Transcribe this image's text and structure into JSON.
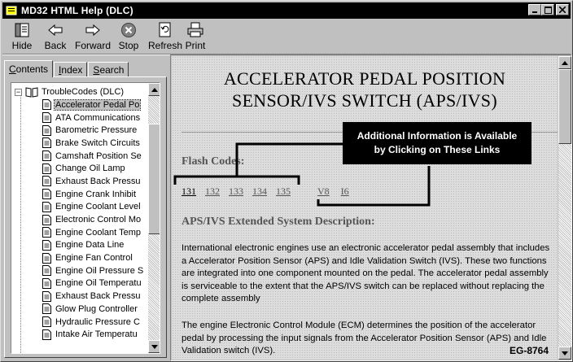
{
  "window": {
    "title": "MD32 HTML Help (DLC)"
  },
  "toolbar": {
    "buttons": [
      {
        "label": "Hide",
        "icon": "hide-icon"
      },
      {
        "label": "Back",
        "icon": "back-arrow-icon"
      },
      {
        "label": "Forward",
        "icon": "forward-arrow-icon"
      },
      {
        "label": "Stop",
        "icon": "stop-icon"
      },
      {
        "label": "Refresh",
        "icon": "refresh-icon"
      },
      {
        "label": "Print",
        "icon": "print-icon"
      }
    ]
  },
  "tabs": [
    {
      "label": "Contents",
      "underline": "C",
      "rest": "ontents",
      "active": true
    },
    {
      "label": "Index",
      "underline": "I",
      "rest": "ndex",
      "active": false
    },
    {
      "label": "Search",
      "underline": "S",
      "rest": "earch",
      "active": false
    }
  ],
  "tree": {
    "root": {
      "label": "TroubleCodes (DLC)",
      "expanded": true
    },
    "items": [
      "Accelerator Pedal Po",
      "ATA Communications",
      "Barometric Pressure",
      "Brake Switch Circuits",
      "Camshaft Position Se",
      "Change Oil Lamp",
      "Exhaust Back Pressu",
      "Engine Crank Inhibit",
      "Engine Coolant Level",
      "Electronic Control Mo",
      "Engine Coolant Temp",
      "Engine Data Line",
      "Engine Fan Control",
      "Engine Oil Pressure S",
      "Engine Oil Temperatu",
      "Exhaust Back Pressu",
      "Glow Plug Controller",
      "Hydraulic Pressure C",
      "Intake Air Temperatu"
    ],
    "selected_index": 0
  },
  "content": {
    "title_line1": "ACCELERATOR PEDAL POSITION",
    "title_line2": "SENSOR/IVS SWITCH (APS/IVS)",
    "callout_line1": "Additional Information is  Available",
    "callout_line2": "by Clicking on These Links",
    "flash_label": "Flash Codes:",
    "flash_codes": [
      "131",
      "132",
      "133",
      "134",
      "135"
    ],
    "extra_links": [
      "V8",
      "I6"
    ],
    "section_title": "APS/IVS Extended System Description:",
    "paragraph1": "International electronic engines use an electronic accelerator pedal assembly that includes a Accelerator Position Sensor (APS) and Idle Validation Switch (IVS).  These two functions are integrated into one component mounted on the pedal.  The accelerator pedal assembly is serviceable to the extent that the APS/IVS switch can be replaced without replacing the complete assembly",
    "paragraph2": "The engine Electronic Control Module (ECM) determines the position of the accelerator pedal by processing the input signals from the Accelerator Position Sensor (APS) and Idle Validation switch (IVS).",
    "figure_id": "EG-8764"
  }
}
